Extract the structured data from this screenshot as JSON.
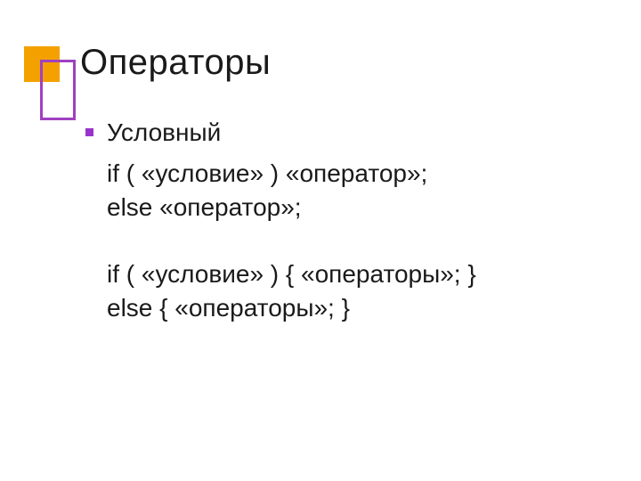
{
  "slide": {
    "title": "Операторы",
    "groups": [
      {
        "bullet_label": "Условный",
        "lines": [
          "if ( «условие» ) «оператор»;",
          "else «оператор»;"
        ]
      },
      {
        "lines": [
          "if ( «условие» ) { «операторы»; }",
          "else { «операторы»; }"
        ]
      }
    ]
  },
  "colors": {
    "accent_orange": "#f4a100",
    "accent_purple": "#a040c0",
    "bullet": "#9933cc"
  }
}
